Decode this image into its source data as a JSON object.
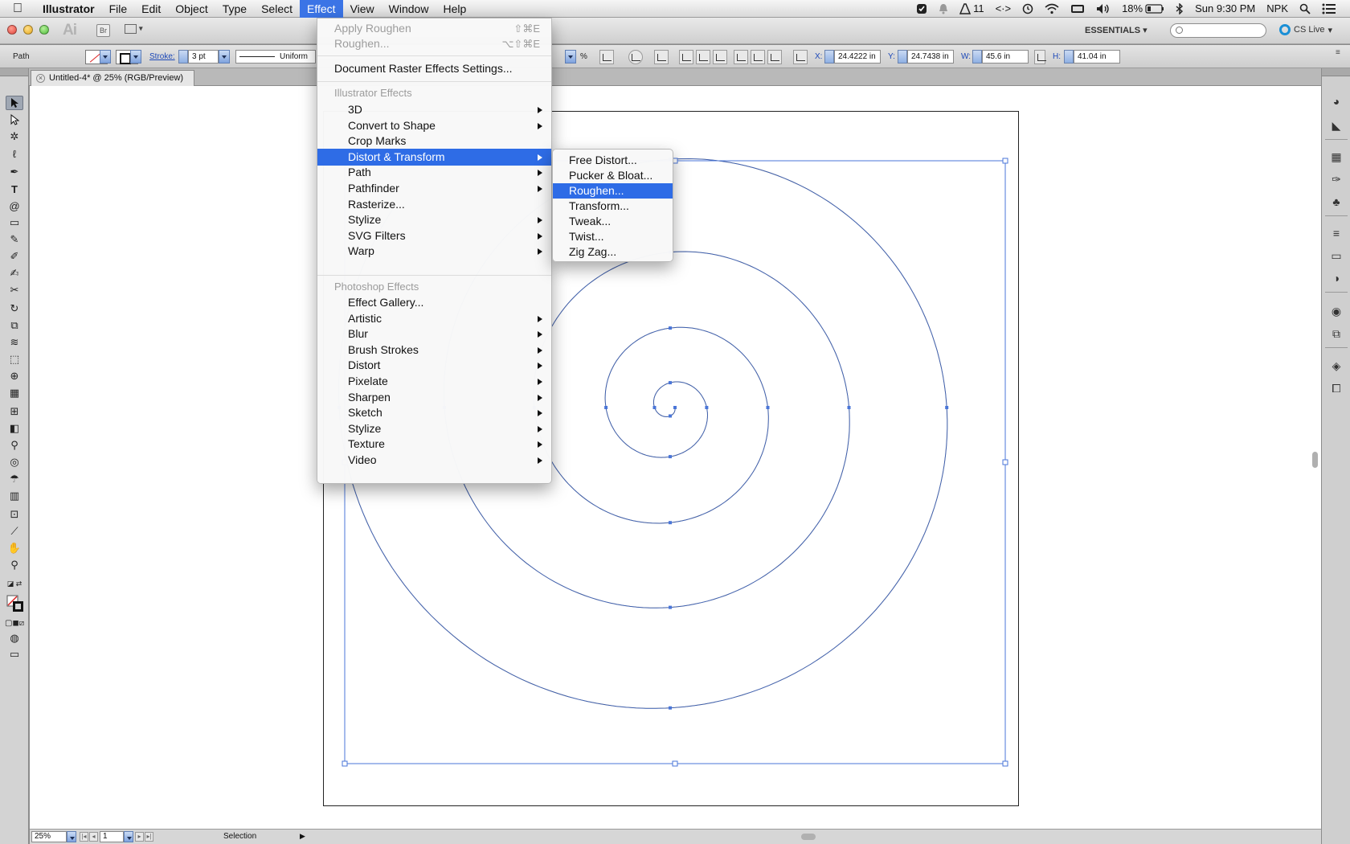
{
  "menubar": {
    "app_name": "Illustrator",
    "items": [
      "File",
      "Edit",
      "Object",
      "Type",
      "Select",
      "Effect",
      "View",
      "Window",
      "Help"
    ],
    "active_item": "Effect",
    "status": {
      "notifications": "11",
      "battery": "18%",
      "clock": "Sun 9:30 PM",
      "user": "NPK"
    }
  },
  "appbar": {
    "logo": "Ai",
    "bridge": "Br",
    "workspace": "ESSENTIALS",
    "cslive": "CS Live"
  },
  "control": {
    "selection_type": "Path",
    "stroke_label": "Stroke:",
    "stroke_weight": "3 pt",
    "profile": "Uniform",
    "opacity_unit": "%",
    "x_label": "X:",
    "x_value": "24.4222 in",
    "y_label": "Y:",
    "y_value": "24.7438 in",
    "w_label": "W:",
    "w_value": "45.6 in",
    "h_label": "H:",
    "h_value": "41.04 in"
  },
  "document": {
    "tab_title": "Untitled-4* @ 25% (RGB/Preview)"
  },
  "effect_menu": {
    "apply_last": "Apply Roughen",
    "apply_last_shortcut": "⇧⌘E",
    "last_effect": "Roughen...",
    "last_effect_shortcut": "⌥⇧⌘E",
    "raster_settings": "Document Raster Effects Settings...",
    "illustrator_header": "Illustrator Effects",
    "illustrator_items": [
      {
        "label": "3D",
        "submenu": true
      },
      {
        "label": "Convert to Shape",
        "submenu": true
      },
      {
        "label": "Crop Marks",
        "submenu": false
      },
      {
        "label": "Distort & Transform",
        "submenu": true
      },
      {
        "label": "Path",
        "submenu": true
      },
      {
        "label": "Pathfinder",
        "submenu": true
      },
      {
        "label": "Rasterize...",
        "submenu": false
      },
      {
        "label": "Stylize",
        "submenu": true
      },
      {
        "label": "SVG Filters",
        "submenu": true
      },
      {
        "label": "Warp",
        "submenu": true
      }
    ],
    "highlighted": "Distort & Transform",
    "photoshop_header": "Photoshop Effects",
    "photoshop_items": [
      {
        "label": "Effect Gallery...",
        "submenu": false
      },
      {
        "label": "Artistic",
        "submenu": true
      },
      {
        "label": "Blur",
        "submenu": true
      },
      {
        "label": "Brush Strokes",
        "submenu": true
      },
      {
        "label": "Distort",
        "submenu": true
      },
      {
        "label": "Pixelate",
        "submenu": true
      },
      {
        "label": "Sharpen",
        "submenu": true
      },
      {
        "label": "Sketch",
        "submenu": true
      },
      {
        "label": "Stylize",
        "submenu": true
      },
      {
        "label": "Texture",
        "submenu": true
      },
      {
        "label": "Video",
        "submenu": true
      }
    ]
  },
  "submenu": {
    "items": [
      "Free Distort...",
      "Pucker & Bloat...",
      "Roughen...",
      "Transform...",
      "Tweak...",
      "Twist...",
      "Zig Zag..."
    ],
    "highlighted": "Roughen..."
  },
  "statusbar": {
    "zoom": "25%",
    "artboard": "1",
    "tool_info": "Selection"
  },
  "colors": {
    "selection_blue": "#4a76d8",
    "menu_highlight": "#2e6ce6"
  }
}
